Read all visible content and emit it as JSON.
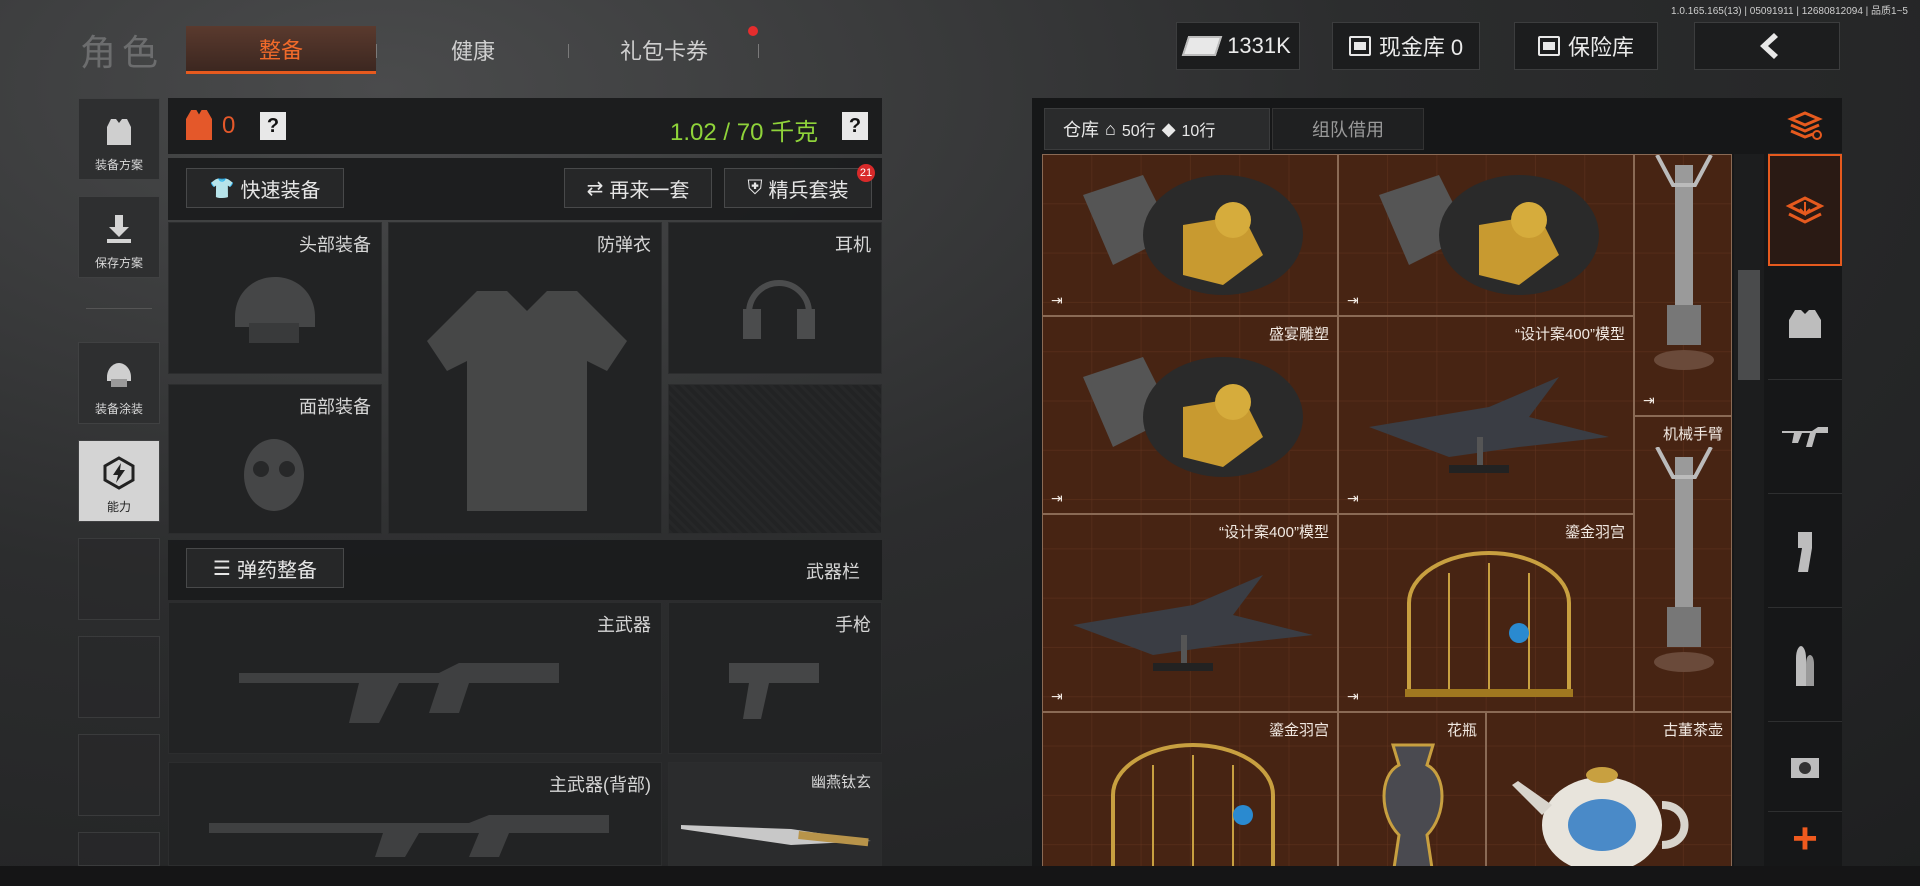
{
  "version": "1.0.165.165(13) | 05091911 | 12680812094 | 品质1~5",
  "app_title": "角色",
  "tabs": [
    {
      "label": "整备",
      "active": true
    },
    {
      "label": "健康",
      "active": false
    },
    {
      "label": "礼包卡券",
      "active": false,
      "has_dot": true
    }
  ],
  "currency": {
    "value": "1331K"
  },
  "cash_vault": {
    "label": "现金库 0"
  },
  "safe_vault": {
    "label": "保险库"
  },
  "sidebar": [
    {
      "label": "装备方案",
      "icon": "vest-icon"
    },
    {
      "label": "保存方案",
      "icon": "download-icon"
    },
    {
      "label": "装备涂装",
      "icon": "helmet-skin-icon"
    },
    {
      "label": "能力",
      "icon": "ability-icon",
      "active": true
    }
  ],
  "equipment": {
    "armor_count": "0",
    "weight": "1.02 / 70 千克",
    "quick_equip": "快速装备",
    "again": "再来一套",
    "elite": "精兵套装",
    "elite_badge": "21",
    "slots": {
      "head": "头部装备",
      "vest": "防弹衣",
      "headset": "耳机",
      "face": "面部装备"
    },
    "ammo": "弹药整备",
    "weapon_bar": "武器栏",
    "weapons": {
      "primary": "主武器",
      "pistol": "手枪",
      "primary_back": "主武器(背部)",
      "melee": "幽燕钛玄"
    }
  },
  "warehouse": {
    "tab_main": "仓库",
    "rows_a": "50行",
    "rows_b": "10行",
    "tab_team": "组队借用",
    "items": [
      {
        "name": "",
        "img": "sculpture"
      },
      {
        "name": "",
        "img": "sculpture"
      },
      {
        "name": "",
        "img": "arm"
      },
      {
        "name": "盛宴雕塑",
        "img": "sculpture"
      },
      {
        "name": "“设计案400”模型",
        "img": "plane"
      },
      {
        "name": "机械手臂",
        "img": "arm"
      },
      {
        "name": "“设计案400”模型",
        "img": "plane"
      },
      {
        "name": "鎏金羽宫",
        "img": "cage"
      },
      {
        "name": "鎏金羽宫",
        "img": "cage"
      },
      {
        "name": "花瓶",
        "img": "vase"
      },
      {
        "name": "古董茶壶",
        "img": "teapot"
      }
    ]
  },
  "rail": [
    "stack-refresh-icon",
    "stack-download-icon",
    "vest-icon",
    "rifle-icon",
    "magazine-icon",
    "bullets-icon",
    "scope-icon",
    "plus-icon"
  ]
}
